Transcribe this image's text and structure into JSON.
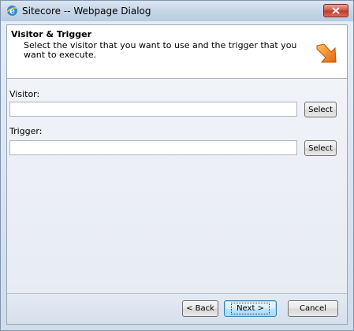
{
  "window": {
    "title": "Sitecore -- Webpage Dialog"
  },
  "header": {
    "title": "Visitor & Trigger",
    "description": "Select the visitor that you want to use and the trigger that you want to execute."
  },
  "fields": {
    "visitor": {
      "label": "Visitor:",
      "value": "",
      "button": "Select"
    },
    "trigger": {
      "label": "Trigger:",
      "value": "",
      "button": "Select"
    }
  },
  "footer": {
    "back": "< Back",
    "next": "Next >",
    "cancel": "Cancel"
  },
  "colors": {
    "accent_orange": "#f08a1c",
    "close_red": "#c2392b"
  },
  "icons": {
    "title": "ie-icon",
    "close": "close-icon",
    "header": "arrow-icon"
  }
}
